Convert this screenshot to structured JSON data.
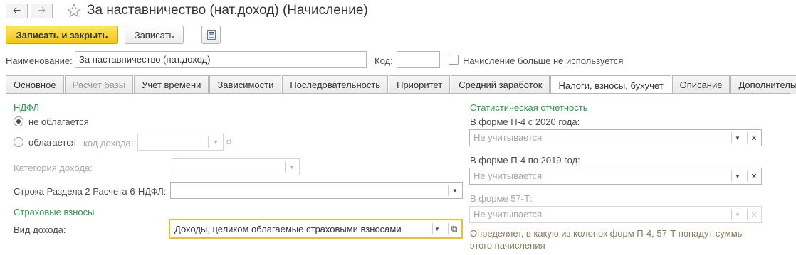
{
  "window": {
    "title": "За наставничество (нат.доход) (Начисление)",
    "back_icon": "arrow-left-icon",
    "forward_icon": "arrow-right-icon",
    "favorite_icon": "star-icon"
  },
  "toolbar": {
    "save_close_label": "Записать и закрыть",
    "save_label": "Записать",
    "more_icon": "document-list-icon"
  },
  "header": {
    "name_label": "Наименование:",
    "name_value": "За наставничество (нат.доход)",
    "code_label": "Код:",
    "code_value": "",
    "unused_checkbox_label": "Начисление больше не используется"
  },
  "tabs": [
    {
      "label": "Основное",
      "state": "normal"
    },
    {
      "label": "Расчет базы",
      "state": "disabled"
    },
    {
      "label": "Учет времени",
      "state": "normal"
    },
    {
      "label": "Зависимости",
      "state": "normal"
    },
    {
      "label": "Последовательность",
      "state": "normal"
    },
    {
      "label": "Приоритет",
      "state": "normal"
    },
    {
      "label": "Средний заработок",
      "state": "normal"
    },
    {
      "label": "Налоги, взносы, бухучет",
      "state": "active"
    },
    {
      "label": "Описание",
      "state": "normal"
    },
    {
      "label": "Дополнительно",
      "state": "normal"
    }
  ],
  "ndfl": {
    "section_title": "НДФЛ",
    "option_not_taxed": "не облагается",
    "option_taxed": "облагается",
    "income_code_label": "код дохода:",
    "income_code_value": "",
    "income_category_label": "Категория дохода:",
    "income_category_value": "",
    "report_line_label": "Строка Раздела 2 Расчета 6-НДФЛ:",
    "report_line_value": ""
  },
  "insurance": {
    "section_title": "Страховые взносы",
    "income_type_label": "Вид дохода:",
    "income_type_value": "Доходы, целиком облагаемые страховыми взносами"
  },
  "stats": {
    "section_title": "Статистическая отчетность",
    "p4_2020_label": "В форме П-4 с 2020 года:",
    "p4_2020_value": "Не учитывается",
    "p4_2019_label": "В форме П-4 по 2019 год:",
    "p4_2019_value": "Не учитывается",
    "f57t_label": "В форме 57-Т:",
    "f57t_value": "Не учитывается",
    "hint": "Определяет, в какую из колонок форм П-4, 57-Т попадут суммы этого начисления"
  }
}
